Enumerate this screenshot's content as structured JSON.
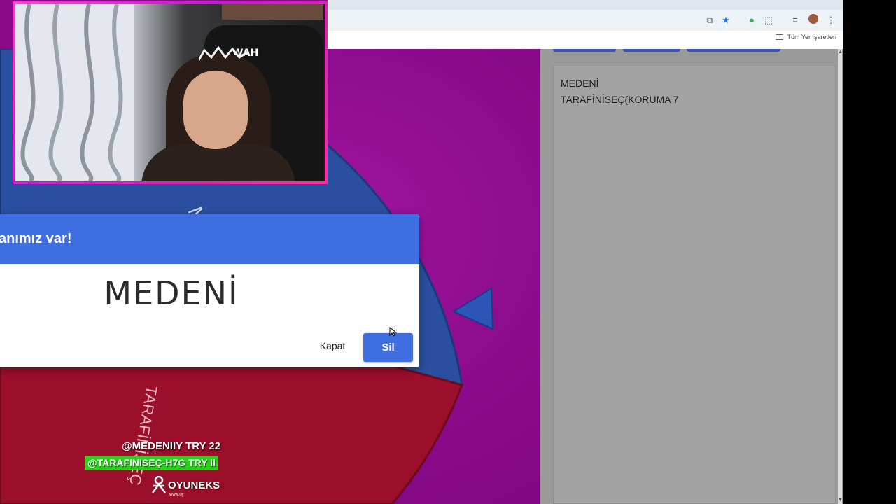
{
  "browser": {
    "bookmarks_label": "Tüm Yer İşaretleri"
  },
  "dialog": {
    "title": "anımız var!",
    "word": "MEDENİ",
    "close_label": "Kapat",
    "delete_label": "Sil",
    "accent_color": "#3f6ee0"
  },
  "wheel": {
    "segment_label_top": "M",
    "segment_label_bottom": "TARAFİNİSEÇ",
    "colors": [
      "#2b4fa0",
      "#9c0f2a"
    ]
  },
  "entries": {
    "lines": [
      "MEDENİ",
      "TARAFİNİSEÇ(KORUMA 7"
    ]
  },
  "webcam": {
    "chair_logo": "WAH"
  },
  "overlay": {
    "line1": "@MEDENIIY  TRY 22",
    "line2": "@TARAFINISEÇ-H7G  TRY II",
    "logo": "OYUNEKS",
    "logo_sub": "www.oy"
  },
  "icons": {
    "translate": "translate-icon",
    "star": "star-icon",
    "extension": "extension-icon",
    "puzzle": "puzzle-icon",
    "menu": "menu-icon"
  }
}
